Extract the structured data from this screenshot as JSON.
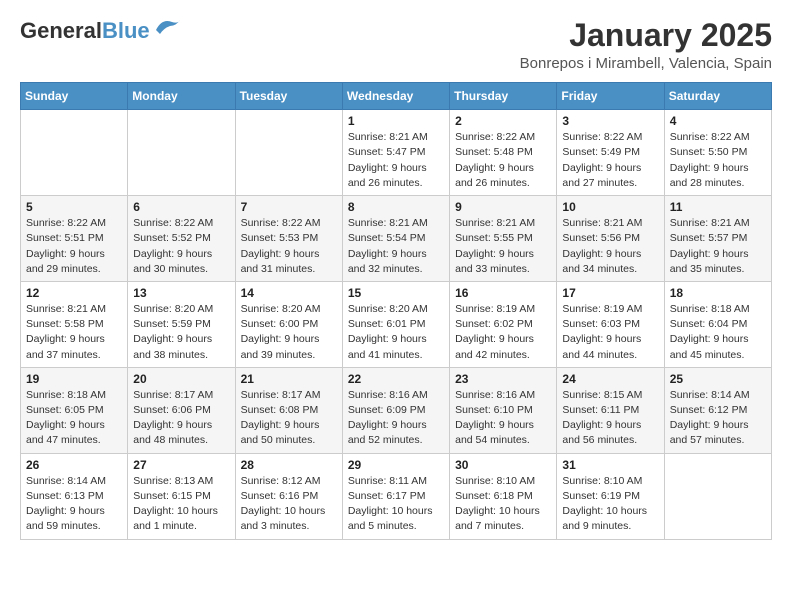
{
  "header": {
    "logo_general": "General",
    "logo_blue": "Blue",
    "month": "January 2025",
    "location": "Bonrepos i Mirambell, Valencia, Spain"
  },
  "days_of_week": [
    "Sunday",
    "Monday",
    "Tuesday",
    "Wednesday",
    "Thursday",
    "Friday",
    "Saturday"
  ],
  "weeks": [
    [
      {
        "num": "",
        "info": ""
      },
      {
        "num": "",
        "info": ""
      },
      {
        "num": "",
        "info": ""
      },
      {
        "num": "1",
        "info": "Sunrise: 8:21 AM\nSunset: 5:47 PM\nDaylight: 9 hours and 26 minutes."
      },
      {
        "num": "2",
        "info": "Sunrise: 8:22 AM\nSunset: 5:48 PM\nDaylight: 9 hours and 26 minutes."
      },
      {
        "num": "3",
        "info": "Sunrise: 8:22 AM\nSunset: 5:49 PM\nDaylight: 9 hours and 27 minutes."
      },
      {
        "num": "4",
        "info": "Sunrise: 8:22 AM\nSunset: 5:50 PM\nDaylight: 9 hours and 28 minutes."
      }
    ],
    [
      {
        "num": "5",
        "info": "Sunrise: 8:22 AM\nSunset: 5:51 PM\nDaylight: 9 hours and 29 minutes."
      },
      {
        "num": "6",
        "info": "Sunrise: 8:22 AM\nSunset: 5:52 PM\nDaylight: 9 hours and 30 minutes."
      },
      {
        "num": "7",
        "info": "Sunrise: 8:22 AM\nSunset: 5:53 PM\nDaylight: 9 hours and 31 minutes."
      },
      {
        "num": "8",
        "info": "Sunrise: 8:21 AM\nSunset: 5:54 PM\nDaylight: 9 hours and 32 minutes."
      },
      {
        "num": "9",
        "info": "Sunrise: 8:21 AM\nSunset: 5:55 PM\nDaylight: 9 hours and 33 minutes."
      },
      {
        "num": "10",
        "info": "Sunrise: 8:21 AM\nSunset: 5:56 PM\nDaylight: 9 hours and 34 minutes."
      },
      {
        "num": "11",
        "info": "Sunrise: 8:21 AM\nSunset: 5:57 PM\nDaylight: 9 hours and 35 minutes."
      }
    ],
    [
      {
        "num": "12",
        "info": "Sunrise: 8:21 AM\nSunset: 5:58 PM\nDaylight: 9 hours and 37 minutes."
      },
      {
        "num": "13",
        "info": "Sunrise: 8:20 AM\nSunset: 5:59 PM\nDaylight: 9 hours and 38 minutes."
      },
      {
        "num": "14",
        "info": "Sunrise: 8:20 AM\nSunset: 6:00 PM\nDaylight: 9 hours and 39 minutes."
      },
      {
        "num": "15",
        "info": "Sunrise: 8:20 AM\nSunset: 6:01 PM\nDaylight: 9 hours and 41 minutes."
      },
      {
        "num": "16",
        "info": "Sunrise: 8:19 AM\nSunset: 6:02 PM\nDaylight: 9 hours and 42 minutes."
      },
      {
        "num": "17",
        "info": "Sunrise: 8:19 AM\nSunset: 6:03 PM\nDaylight: 9 hours and 44 minutes."
      },
      {
        "num": "18",
        "info": "Sunrise: 8:18 AM\nSunset: 6:04 PM\nDaylight: 9 hours and 45 minutes."
      }
    ],
    [
      {
        "num": "19",
        "info": "Sunrise: 8:18 AM\nSunset: 6:05 PM\nDaylight: 9 hours and 47 minutes."
      },
      {
        "num": "20",
        "info": "Sunrise: 8:17 AM\nSunset: 6:06 PM\nDaylight: 9 hours and 48 minutes."
      },
      {
        "num": "21",
        "info": "Sunrise: 8:17 AM\nSunset: 6:08 PM\nDaylight: 9 hours and 50 minutes."
      },
      {
        "num": "22",
        "info": "Sunrise: 8:16 AM\nSunset: 6:09 PM\nDaylight: 9 hours and 52 minutes."
      },
      {
        "num": "23",
        "info": "Sunrise: 8:16 AM\nSunset: 6:10 PM\nDaylight: 9 hours and 54 minutes."
      },
      {
        "num": "24",
        "info": "Sunrise: 8:15 AM\nSunset: 6:11 PM\nDaylight: 9 hours and 56 minutes."
      },
      {
        "num": "25",
        "info": "Sunrise: 8:14 AM\nSunset: 6:12 PM\nDaylight: 9 hours and 57 minutes."
      }
    ],
    [
      {
        "num": "26",
        "info": "Sunrise: 8:14 AM\nSunset: 6:13 PM\nDaylight: 9 hours and 59 minutes."
      },
      {
        "num": "27",
        "info": "Sunrise: 8:13 AM\nSunset: 6:15 PM\nDaylight: 10 hours and 1 minute."
      },
      {
        "num": "28",
        "info": "Sunrise: 8:12 AM\nSunset: 6:16 PM\nDaylight: 10 hours and 3 minutes."
      },
      {
        "num": "29",
        "info": "Sunrise: 8:11 AM\nSunset: 6:17 PM\nDaylight: 10 hours and 5 minutes."
      },
      {
        "num": "30",
        "info": "Sunrise: 8:10 AM\nSunset: 6:18 PM\nDaylight: 10 hours and 7 minutes."
      },
      {
        "num": "31",
        "info": "Sunrise: 8:10 AM\nSunset: 6:19 PM\nDaylight: 10 hours and 9 minutes."
      },
      {
        "num": "",
        "info": ""
      }
    ]
  ]
}
